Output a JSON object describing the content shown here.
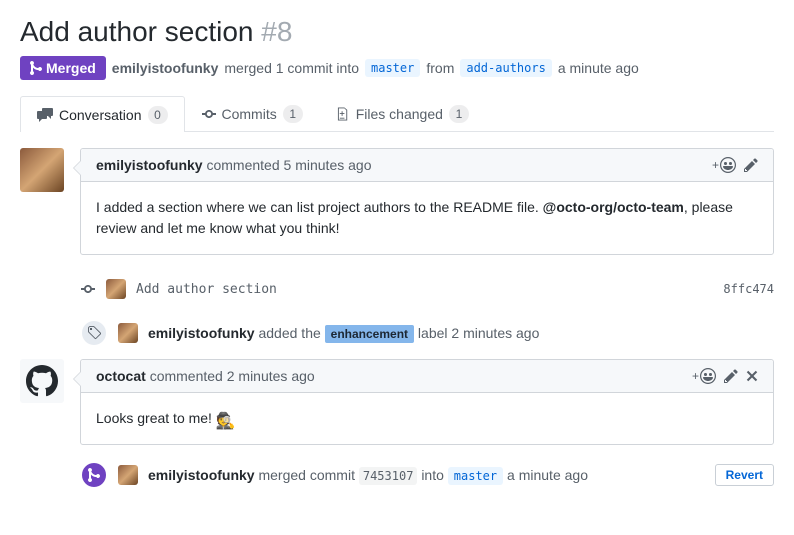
{
  "header": {
    "title": "Add author section",
    "issue_number": "#8",
    "state": "Merged",
    "actor": "emilyistoofunky",
    "action_text": "merged 1 commit into",
    "base_branch": "master",
    "from_text": "from",
    "head_branch": "add-authors",
    "time": "a minute ago"
  },
  "tabs": {
    "conversation": {
      "label": "Conversation",
      "count": "0"
    },
    "commits": {
      "label": "Commits",
      "count": "1"
    },
    "files": {
      "label": "Files changed",
      "count": "1"
    }
  },
  "comments": [
    {
      "author": "emilyistoofunky",
      "verb": "commented",
      "time": "5 minutes ago",
      "body_pre": "I added a section where we can list project authors to the README file. ",
      "mention": "@octo-org/octo-team",
      "body_post": ", please review and let me know what you think!"
    },
    {
      "author": "octocat",
      "verb": "commented",
      "time": "2 minutes ago",
      "body": "Looks great to me! "
    }
  ],
  "commit": {
    "message": "Add author section",
    "sha": "8ffc474"
  },
  "label_event": {
    "actor": "emilyistoofunky",
    "verb": "added the",
    "label": "enhancement",
    "suffix": "label",
    "time": "2 minutes ago"
  },
  "merge_event": {
    "actor": "emilyistoofunky",
    "verb": "merged commit",
    "sha": "7453107",
    "into": "into",
    "branch": "master",
    "time": "a minute ago",
    "revert": "Revert"
  }
}
